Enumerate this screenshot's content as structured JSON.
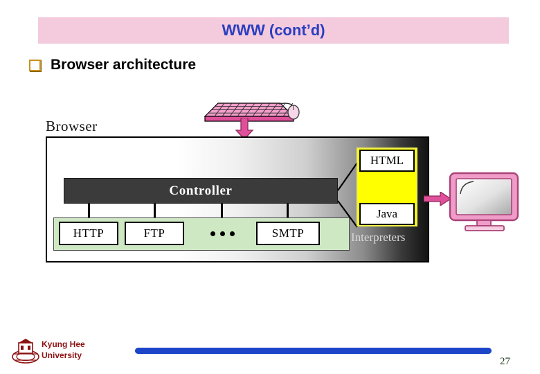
{
  "slide": {
    "title": "WWW (cont’d)",
    "title_color": "#2a3ec0",
    "banner_color": "#f3cbdd",
    "page_number": "27"
  },
  "bullet": {
    "marker": "hollow-square-bullet",
    "marker_color": "#c8901c",
    "text": "Browser architecture"
  },
  "diagram": {
    "browser_caption": "Browser",
    "controller": {
      "label": "Controller",
      "bg_color": "#3b3b3b",
      "text_color": "#ffffff"
    },
    "protocols": {
      "panel_color": "#cfe8c4",
      "items": [
        {
          "label": "HTTP"
        },
        {
          "label": "FTP"
        },
        {
          "label": "SMTP"
        }
      ],
      "ellipsis": "•••"
    },
    "interpreters": {
      "caption": "Interpreters",
      "panel_color": "#ffff00",
      "items": [
        {
          "label": "HTML"
        },
        {
          "label": "Java"
        }
      ]
    },
    "input_devices": {
      "keyboard": "keyboard-icon",
      "mouse": "mouse-icon",
      "arrow": "down-arrow-icon",
      "accent_color": "#e0509a"
    },
    "output_device": {
      "monitor": "monitor-icon",
      "arrow": "right-arrow-icon",
      "accent_color": "#e0509a"
    }
  },
  "footer": {
    "logo": "kyung-hee-crest-icon",
    "university_line1": "Kyung Hee",
    "university_line2": "University",
    "text_color": "#8c1111",
    "rule_color": "#1c45c8"
  }
}
